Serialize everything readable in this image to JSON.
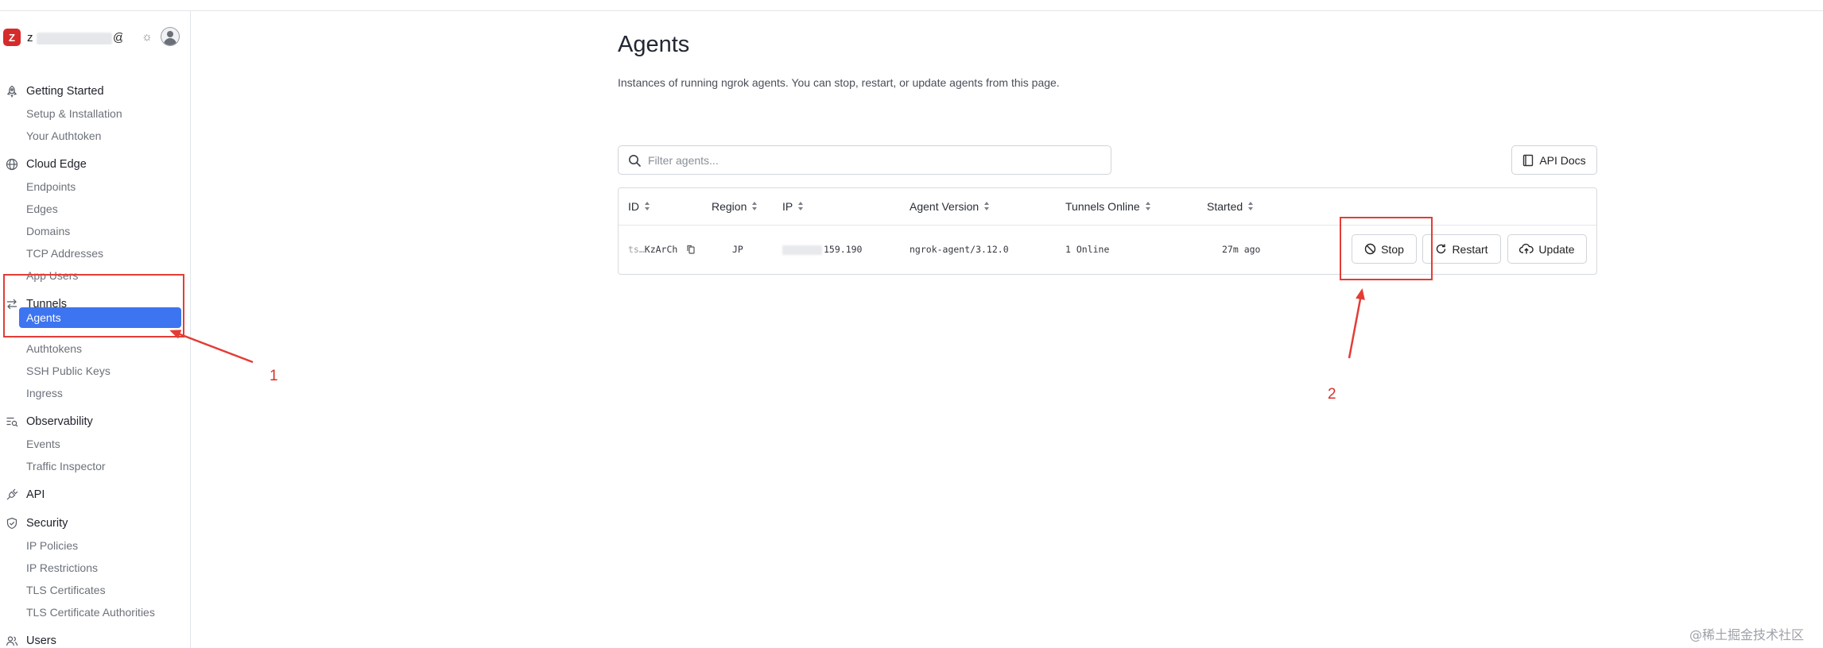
{
  "account": {
    "badge": "Z",
    "email_prefix": "z",
    "email_suffix": "@g...",
    "theme_icon": "sun-icon",
    "avatar_icon": "user-avatar-icon"
  },
  "sidebar": {
    "sections": [
      {
        "label": "Getting Started",
        "icon": "rocket-icon",
        "items": [
          "Setup & Installation",
          "Your Authtoken"
        ]
      },
      {
        "label": "Cloud Edge",
        "icon": "globe-icon",
        "items": [
          "Endpoints",
          "Edges",
          "Domains",
          "TCP Addresses",
          "App Users"
        ]
      },
      {
        "label": "Tunnels",
        "icon": "arrows-swap-icon",
        "items": [
          "Agents",
          "Authtokens",
          "SSH Public Keys",
          "Ingress"
        ]
      },
      {
        "label": "Observability",
        "icon": "list-search-icon",
        "items": [
          "Events",
          "Traffic Inspector"
        ]
      },
      {
        "label": "API",
        "icon": "plug-icon",
        "items": []
      },
      {
        "label": "Security",
        "icon": "shield-icon",
        "items": [
          "IP Policies",
          "IP Restrictions",
          "TLS Certificates",
          "TLS Certificate Authorities"
        ]
      },
      {
        "label": "Users",
        "icon": "users-icon",
        "items": []
      }
    ],
    "active_item": "Agents"
  },
  "main": {
    "title": "Agents",
    "description": "Instances of running ngrok agents. You can stop, restart, or update agents from this page.",
    "filter_placeholder": "Filter agents...",
    "api_docs_label": "API Docs"
  },
  "table": {
    "headers": [
      "ID",
      "Region",
      "IP",
      "Agent Version",
      "Tunnels Online",
      "Started"
    ],
    "rows": [
      {
        "id_prefix": "ts…",
        "id_suffix": "KzArCh",
        "region": "JP",
        "ip_suffix": "159.190",
        "agent_version": "ngrok-agent/3.12.0",
        "tunnels_online": "1 Online",
        "started": "27m ago"
      }
    ],
    "actions": {
      "stop": "Stop",
      "restart": "Restart",
      "update": "Update"
    }
  },
  "annotations": {
    "label_1": "1",
    "label_2": "2",
    "color": "#e43c35"
  },
  "watermark": "@稀土掘金技术社区"
}
